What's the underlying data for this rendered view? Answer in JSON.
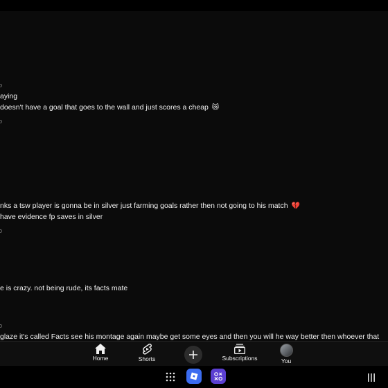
{
  "comments": [
    {
      "id": "c1",
      "lines": [
        "aying",
        "doesn't have a goal that goes to the wall and just scores a cheap"
      ],
      "emoji": "😿"
    },
    {
      "id": "c2",
      "lines": [
        "nks a tsw player is gonna be in silver just farming goals rather then not going to his match",
        "have evidence fp saves in silver"
      ],
      "emoji": "💔"
    },
    {
      "id": "c3",
      "lines": [
        "e is crazy. not being rude, its facts mate"
      ]
    },
    {
      "id": "c4",
      "lines": [
        "glaze it's called Facts see his montage again maybe get some eyes and then you will he way better then whoever that"
      ]
    }
  ],
  "nav": {
    "home": "Home",
    "shorts": "Shorts",
    "create": "+",
    "subscriptions": "Subscriptions",
    "you": "You"
  },
  "system_bar": {
    "apps_icon": "grid-icon",
    "app1": "roblox-icon",
    "app2": "game-controller-icon",
    "recents_icon": "recents-icon"
  },
  "colors": {
    "background": "#0b0b0b",
    "text": "#f1f1f1",
    "nav_bg": "#0f0f0f",
    "roblox_blue": "#3b6cf0",
    "app2_purple": "#5b3fd1"
  }
}
